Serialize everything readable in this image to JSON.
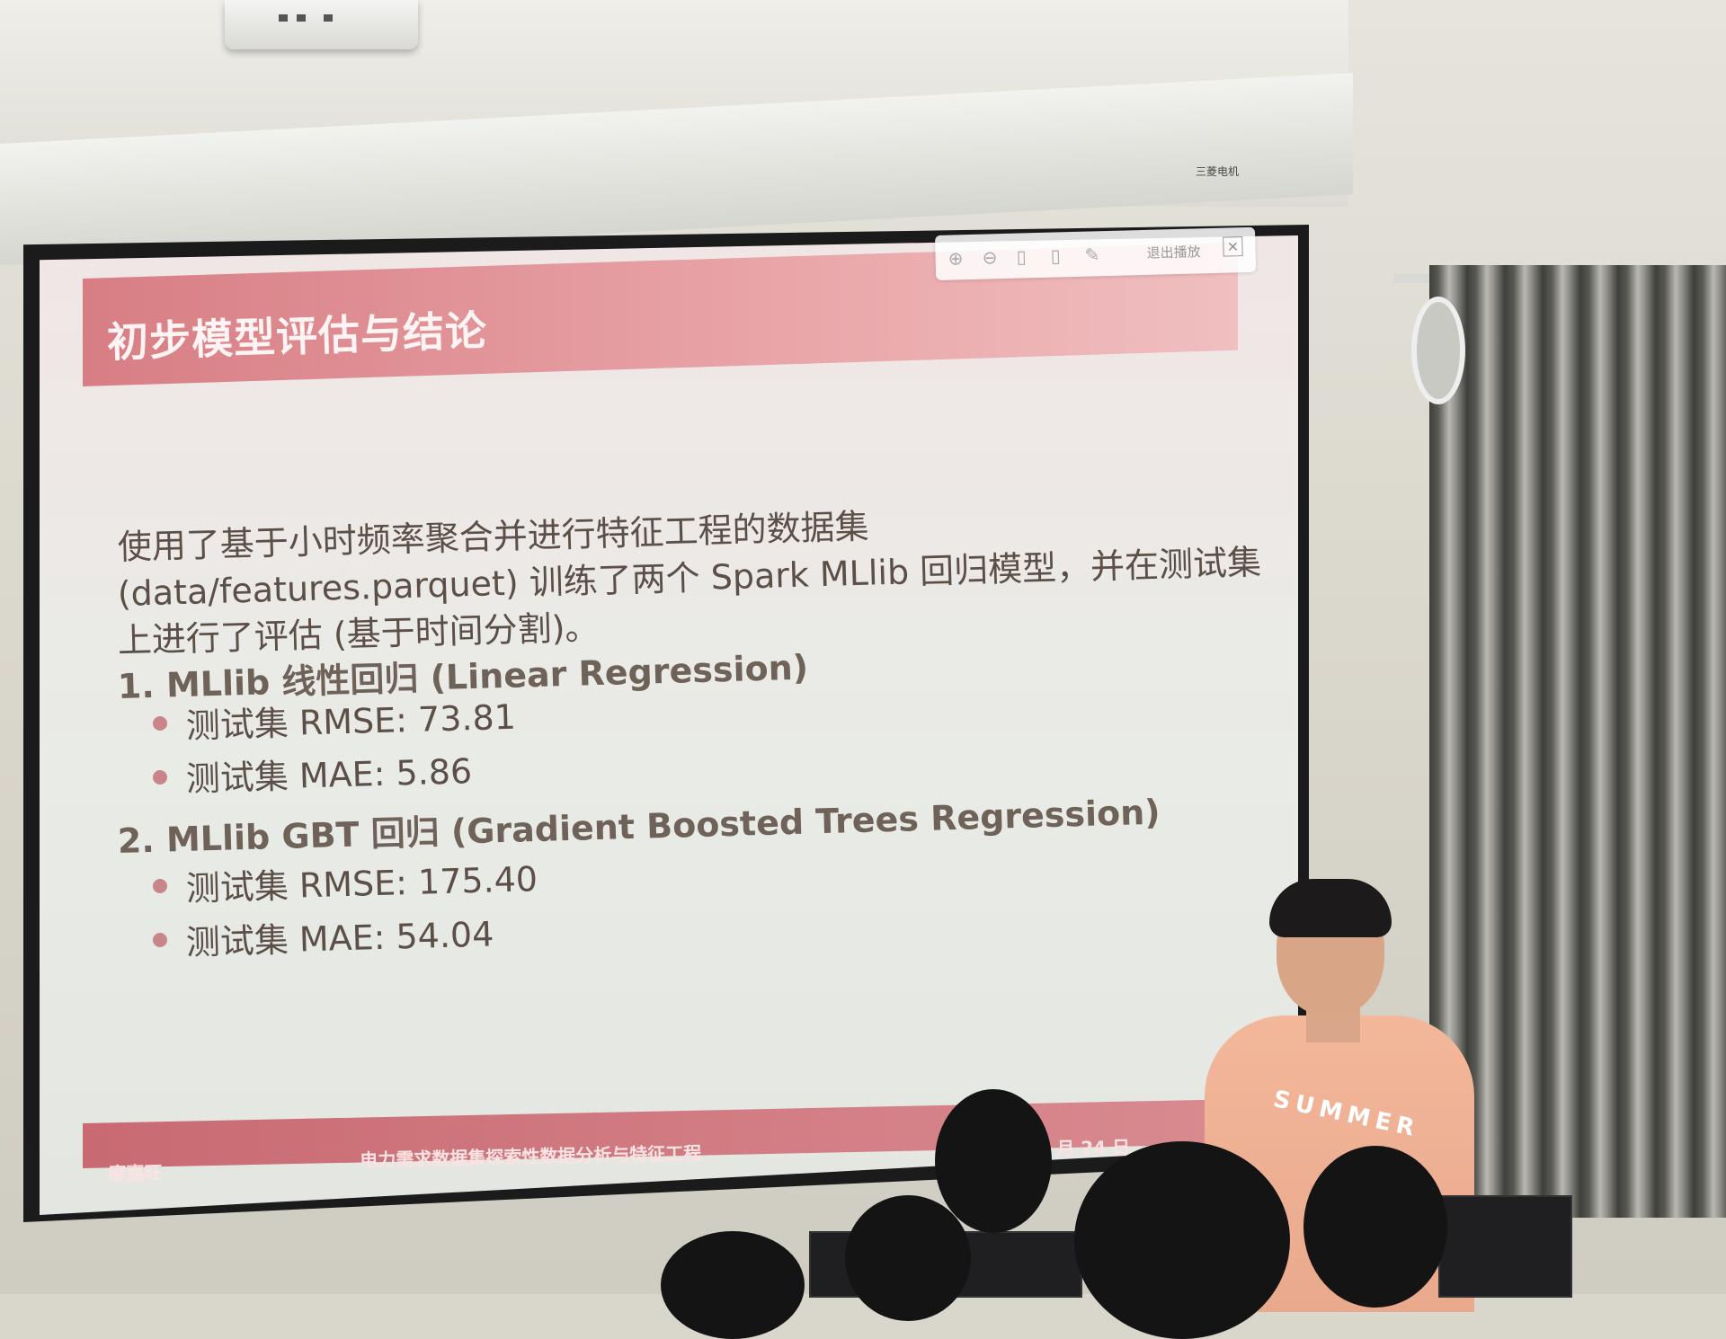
{
  "slide": {
    "title": "初步模型评估与结论",
    "intro_line1": "使用了基于小时频率聚合并进行特征工程的数据集",
    "intro_line2": "(data/features.parquet) 训练了两个 Spark MLlib 回归模型，并在测试集",
    "intro_line3": "上进行了评估 (基于时间分割)。",
    "models": [
      {
        "heading": "1. MLlib 线性回归 (Linear Regression)",
        "metrics": [
          "测试集 RMSE: 73.81",
          "测试集 MAE: 5.86"
        ]
      },
      {
        "heading": "2. MLlib GBT 回归 (Gradient Boosted Trees Regression)",
        "metrics": [
          "测试集 RMSE: 175.40",
          "测试集 MAE: 54.04"
        ]
      }
    ],
    "footer": {
      "author": "廖嘉旺",
      "title": "电力需求数据集探索性数据分析与特征工程",
      "date_fragment": "月 24 日"
    }
  },
  "toolbar": {
    "exit_label": "退出播放",
    "icons": [
      "zoom-in-icon",
      "zoom-out-icon",
      "page-prev-icon",
      "page-next-icon",
      "pen-icon",
      "close-icon"
    ]
  },
  "room": {
    "brand_label": "三菱电机",
    "shirt_print": "SUMMER"
  },
  "colors": {
    "title_bar": "#d77e84",
    "footer_bar": "#c96a72",
    "body_text": "#5b4f47",
    "bullet": "#c9868a",
    "shirt": "#f3b79a"
  }
}
